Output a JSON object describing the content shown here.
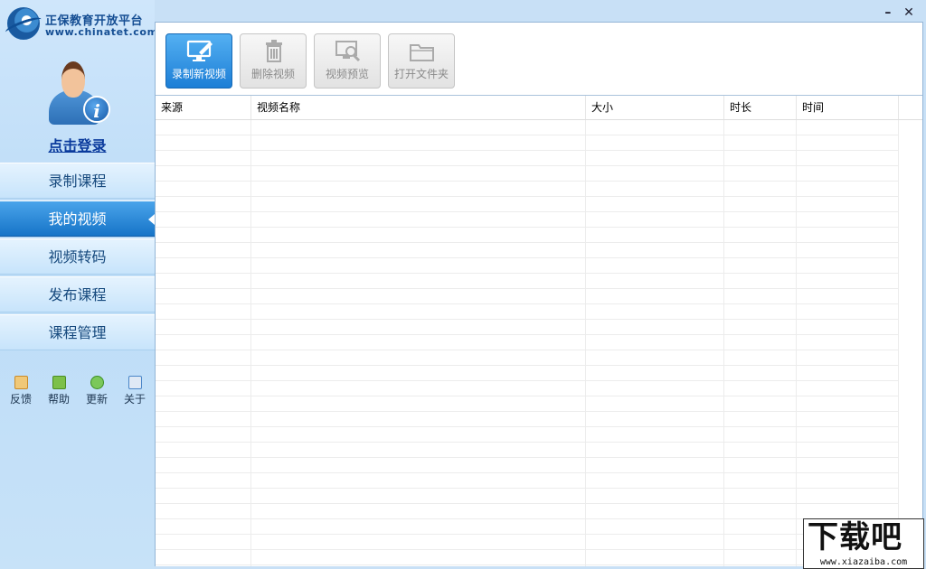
{
  "app": {
    "name_cn": "正保教育开放平台",
    "name_en": "www.chinatet.com"
  },
  "window": {
    "minimize_glyph": "–",
    "close_glyph": "✕"
  },
  "sidebar": {
    "login_label": "点击登录",
    "nav": [
      {
        "label": "录制课程",
        "active": false
      },
      {
        "label": "我的视频",
        "active": true
      },
      {
        "label": "视频转码",
        "active": false
      },
      {
        "label": "发布课程",
        "active": false
      },
      {
        "label": "课程管理",
        "active": false
      }
    ],
    "utilities": [
      {
        "label": "反馈",
        "icon": "feedback-icon",
        "color": "#e8a33a"
      },
      {
        "label": "帮助",
        "icon": "help-icon",
        "color": "#5caa2c"
      },
      {
        "label": "更新",
        "icon": "update-icon",
        "color": "#49a62f"
      },
      {
        "label": "关于",
        "icon": "about-icon",
        "color": "#4a86c8"
      }
    ]
  },
  "toolbar": {
    "buttons": [
      {
        "label": "录制新视频",
        "icon": "record-screen-icon",
        "enabled": true
      },
      {
        "label": "删除视频",
        "icon": "trash-icon",
        "enabled": false
      },
      {
        "label": "视频预览",
        "icon": "preview-icon",
        "enabled": false
      },
      {
        "label": "打开文件夹",
        "icon": "folder-icon",
        "enabled": false
      }
    ]
  },
  "table": {
    "columns": [
      "来源",
      "视频名称",
      "大小",
      "时长",
      "时间"
    ],
    "rows": []
  },
  "watermark": {
    "big": "下载吧",
    "small": "www.xiazaiba.com"
  },
  "colors": {
    "accent": "#1c7ed6",
    "sidebar_bg": "#c8e0f6",
    "active_nav": "#1674c8"
  }
}
